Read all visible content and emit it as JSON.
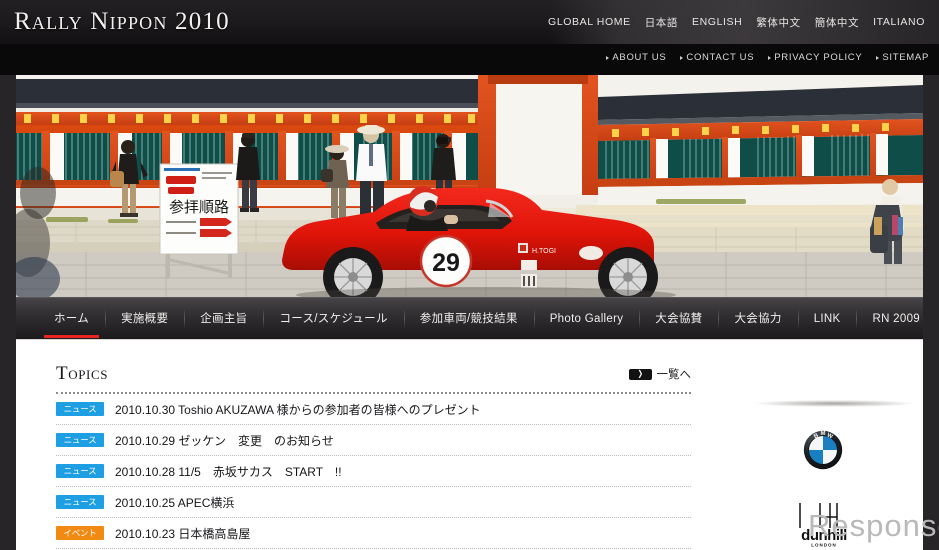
{
  "site": {
    "logo": "Rally Nippon 2010",
    "accent_red": "#e8251e",
    "news_badge_color": "#1f9fe3",
    "event_badge_color": "#f08a12"
  },
  "header": {
    "languages": [
      {
        "label": "GLOBAL HOME"
      },
      {
        "label": "日本語"
      },
      {
        "label": "ENGLISH"
      },
      {
        "label": "繁体中文"
      },
      {
        "label": "簡体中文"
      },
      {
        "label": "ITALIANO"
      }
    ],
    "utility": [
      {
        "label": "ABOUT US"
      },
      {
        "label": "CONTACT US"
      },
      {
        "label": "PRIVACY POLICY"
      },
      {
        "label": "SITEMAP"
      }
    ]
  },
  "hero": {
    "alt": "Red vintage open-top race car number 29 driving past a Japanese shrine building with spectators",
    "car_number": "29",
    "car_sponsor": "H.TOGI",
    "sign_text": "参拝順路"
  },
  "nav": {
    "items": [
      {
        "label": "ホーム",
        "active": true
      },
      {
        "label": "実施概要",
        "active": false
      },
      {
        "label": "企画主旨",
        "active": false
      },
      {
        "label": "コース/スケジュール",
        "active": false
      },
      {
        "label": "参加車両/競技結果",
        "active": false
      },
      {
        "label": "Photo Gallery",
        "active": false
      },
      {
        "label": "大会協賛",
        "active": false
      },
      {
        "label": "大会協力",
        "active": false
      },
      {
        "label": "LINK",
        "active": false
      },
      {
        "label": "RN 2009",
        "active": false
      }
    ]
  },
  "topics": {
    "title": "Topics",
    "more_label": "一覧へ",
    "more_arrow": "❯",
    "items": [
      {
        "badge": "ニュース",
        "type": "news",
        "text": "2010.10.30  Toshio AKUZAWA 様からの参加者の皆様へのプレゼント"
      },
      {
        "badge": "ニュース",
        "type": "news",
        "text": "2010.10.29  ゼッケン　変更　のお知らせ"
      },
      {
        "badge": "ニュース",
        "type": "news",
        "text": "2010.10.28  11/5　赤坂サカス　START　!!"
      },
      {
        "badge": "ニュース",
        "type": "news",
        "text": "2010.10.25  APEC横浜"
      },
      {
        "badge": "イベント",
        "type": "event",
        "text": "2010.10.23  日本橋高島屋"
      }
    ]
  },
  "sidebar": {
    "sponsors": [
      {
        "name": "BMW"
      },
      {
        "name": "dunhill",
        "sub": "LONDON"
      }
    ]
  },
  "watermark": {
    "text": "Response."
  }
}
